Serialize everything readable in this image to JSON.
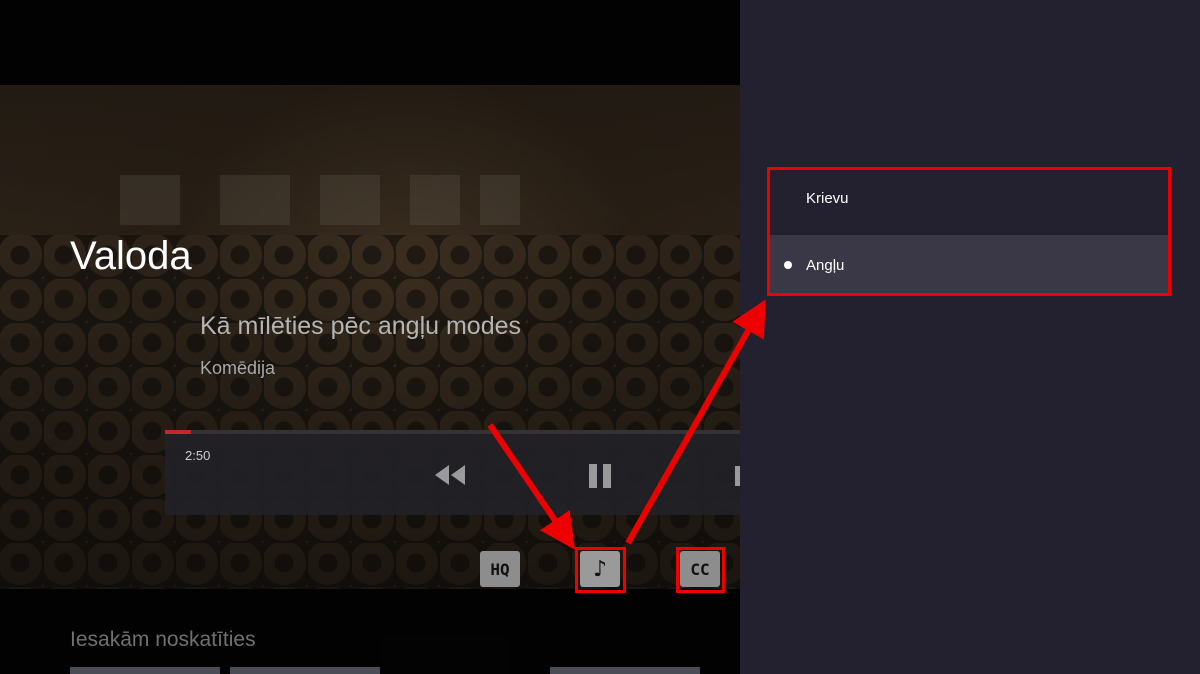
{
  "player": {
    "heading": "Valoda",
    "movie_title": "Kā mīlēties pēc angļu modes",
    "genre": "Komēdija",
    "time": "2:50",
    "progress": 0.045,
    "controls": {
      "rewind_icon": "rewind-icon",
      "pause_icon": "pause-icon",
      "next_icon": "skip-forward-icon"
    },
    "buttons": {
      "hq_label": "HQ",
      "audio_label": "♪",
      "cc_label": "CC"
    },
    "recommend_title": "Iesakām noskatīties"
  },
  "language_panel": {
    "options": [
      {
        "label": "Krievu",
        "selected": false
      },
      {
        "label": "Angļu",
        "selected": true
      }
    ]
  },
  "colors": {
    "panel_bg": "#232130",
    "selected_row": "#3a3846",
    "annotation": "#e00000",
    "progress": "#c2272d"
  }
}
